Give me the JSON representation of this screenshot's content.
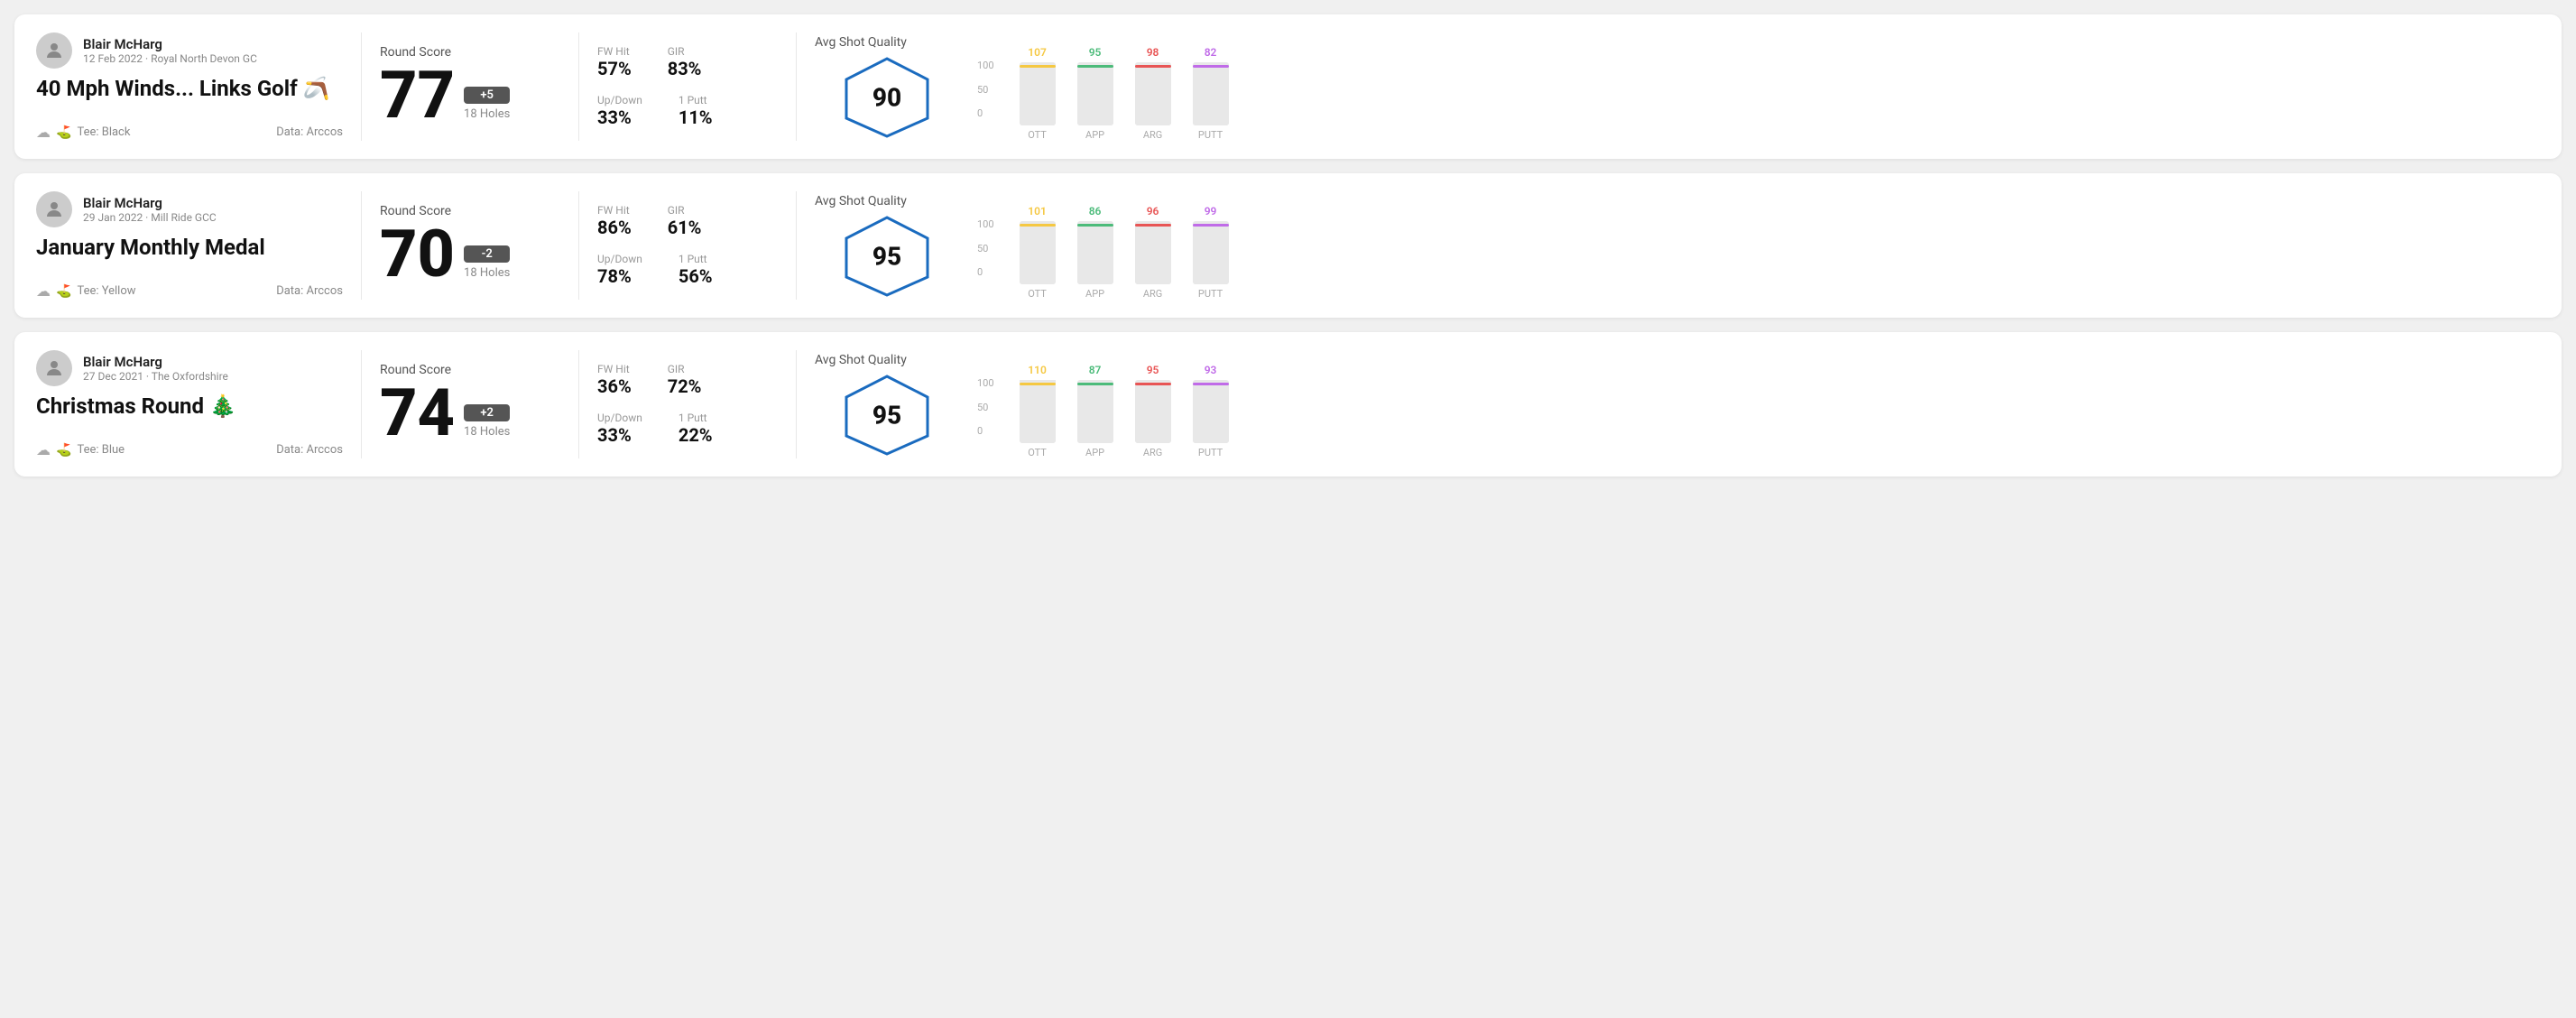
{
  "rounds": [
    {
      "id": "round1",
      "user": {
        "name": "Blair McHarg",
        "date": "12 Feb 2022",
        "club": "Royal North Devon GC"
      },
      "title": "40 Mph Winds... Links Golf 🪃",
      "tee": "Black",
      "data_source": "Data: Arccos",
      "score": {
        "label": "Round Score",
        "value": "77",
        "badge": "+5",
        "badge_type": "positive",
        "holes": "18 Holes"
      },
      "stats": {
        "fw_hit_label": "FW Hit",
        "fw_hit_value": "57%",
        "gir_label": "GIR",
        "gir_value": "83%",
        "updown_label": "Up/Down",
        "updown_value": "33%",
        "oneputt_label": "1 Putt",
        "oneputt_value": "11%"
      },
      "quality": {
        "label": "Avg Shot Quality",
        "score": "90"
      },
      "chart": {
        "bars": [
          {
            "label": "OTT",
            "value": 107,
            "color": "#f5c842",
            "max": 110
          },
          {
            "label": "APP",
            "value": 95,
            "color": "#4cbb7a",
            "max": 110
          },
          {
            "label": "ARG",
            "value": 98,
            "color": "#e85555",
            "max": 110
          },
          {
            "label": "PUTT",
            "value": 82,
            "color": "#c06be8",
            "max": 110
          }
        ],
        "y_labels": [
          "100",
          "50",
          "0"
        ]
      }
    },
    {
      "id": "round2",
      "user": {
        "name": "Blair McHarg",
        "date": "29 Jan 2022",
        "club": "Mill Ride GCC"
      },
      "title": "January Monthly Medal",
      "tee": "Yellow",
      "data_source": "Data: Arccos",
      "score": {
        "label": "Round Score",
        "value": "70",
        "badge": "-2",
        "badge_type": "negative",
        "holes": "18 Holes"
      },
      "stats": {
        "fw_hit_label": "FW Hit",
        "fw_hit_value": "86%",
        "gir_label": "GIR",
        "gir_value": "61%",
        "updown_label": "Up/Down",
        "updown_value": "78%",
        "oneputt_label": "1 Putt",
        "oneputt_value": "56%"
      },
      "quality": {
        "label": "Avg Shot Quality",
        "score": "95"
      },
      "chart": {
        "bars": [
          {
            "label": "OTT",
            "value": 101,
            "color": "#f5c842",
            "max": 110
          },
          {
            "label": "APP",
            "value": 86,
            "color": "#4cbb7a",
            "max": 110
          },
          {
            "label": "ARG",
            "value": 96,
            "color": "#e85555",
            "max": 110
          },
          {
            "label": "PUTT",
            "value": 99,
            "color": "#c06be8",
            "max": 110
          }
        ],
        "y_labels": [
          "100",
          "50",
          "0"
        ]
      }
    },
    {
      "id": "round3",
      "user": {
        "name": "Blair McHarg",
        "date": "27 Dec 2021",
        "club": "The Oxfordshire"
      },
      "title": "Christmas Round 🎄",
      "tee": "Blue",
      "data_source": "Data: Arccos",
      "score": {
        "label": "Round Score",
        "value": "74",
        "badge": "+2",
        "badge_type": "positive",
        "holes": "18 Holes"
      },
      "stats": {
        "fw_hit_label": "FW Hit",
        "fw_hit_value": "36%",
        "gir_label": "GIR",
        "gir_value": "72%",
        "updown_label": "Up/Down",
        "updown_value": "33%",
        "oneputt_label": "1 Putt",
        "oneputt_value": "22%"
      },
      "quality": {
        "label": "Avg Shot Quality",
        "score": "95"
      },
      "chart": {
        "bars": [
          {
            "label": "OTT",
            "value": 110,
            "color": "#f5c842",
            "max": 115
          },
          {
            "label": "APP",
            "value": 87,
            "color": "#4cbb7a",
            "max": 115
          },
          {
            "label": "ARG",
            "value": 95,
            "color": "#e85555",
            "max": 115
          },
          {
            "label": "PUTT",
            "value": 93,
            "color": "#c06be8",
            "max": 115
          }
        ],
        "y_labels": [
          "100",
          "50",
          "0"
        ]
      }
    }
  ]
}
